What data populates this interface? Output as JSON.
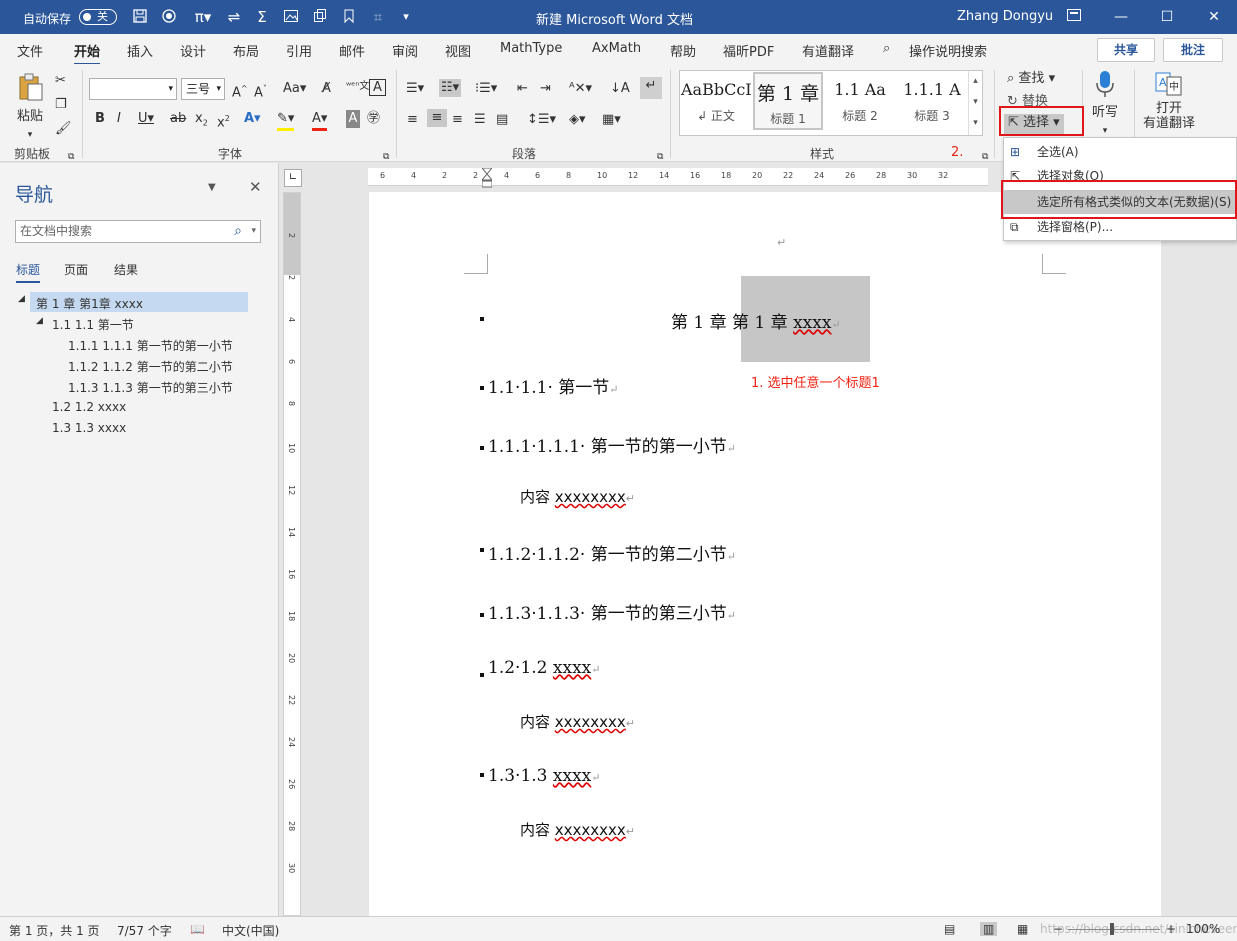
{
  "title_bar": {
    "autosave_label": "自动保存",
    "autosave_state": "关",
    "doc_title": "新建 Microsoft Word 文档",
    "user": "Zhang Dongyu"
  },
  "tabs": [
    "文件",
    "开始",
    "插入",
    "设计",
    "布局",
    "引用",
    "邮件",
    "审阅",
    "视图",
    "MathType",
    "AxMath",
    "帮助",
    "福昕PDF",
    "有道翻译"
  ],
  "active_tab": "开始",
  "tell_me": "操作说明搜索",
  "share_label": "共享",
  "comments_label": "批注",
  "ribbon": {
    "clipboard": {
      "paste": "粘贴",
      "group": "剪贴板"
    },
    "font": {
      "font_name": "",
      "font_size": "三号",
      "group": "字体"
    },
    "paragraph": {
      "group": "段落"
    },
    "styles": {
      "group": "样式",
      "items": [
        {
          "preview": "AaBbCcI",
          "name": "↲ 正文"
        },
        {
          "preview": "第 1 章",
          "name": "标题 1"
        },
        {
          "preview": "1.1  Aa",
          "name": "标题 2"
        },
        {
          "preview": "1.1.1  A",
          "name": "标题 3"
        }
      ]
    },
    "editing": {
      "find": "查找",
      "replace": "替换",
      "select": "选择"
    },
    "voice": {
      "dictate": "听写"
    },
    "translate": {
      "line1": "打开",
      "line2": "有道翻译"
    }
  },
  "select_menu": [
    {
      "label": "全选(A)",
      "icon": "select-all-icon"
    },
    {
      "label": "选择对象(O)",
      "icon": "cursor-icon"
    },
    {
      "label": "选定所有格式类似的文本(无数据)(S)",
      "icon": ""
    },
    {
      "label": "选择窗格(P)...",
      "icon": "selection-pane-icon"
    }
  ],
  "nav": {
    "title": "导航",
    "search_placeholder": "在文档中搜索",
    "tabs": [
      "标题",
      "页面",
      "结果"
    ],
    "items": [
      {
        "text": "第 1 章 第1章 xxxx",
        "level": 1
      },
      {
        "text": "1.1 1.1 第一节",
        "level": 2
      },
      {
        "text": "1.1.1 1.1.1 第一节的第一小节",
        "level": 3
      },
      {
        "text": "1.1.2 1.1.2 第一节的第二小节",
        "level": 3
      },
      {
        "text": "1.1.3 1.1.3 第一节的第三小节",
        "level": 3
      },
      {
        "text": "1.2 1.2 xxxx",
        "level": 2
      },
      {
        "text": "1.3 1.3 xxxx",
        "level": 2
      }
    ]
  },
  "document": {
    "chapter": {
      "prefix": "第 1 章 ",
      "text": "第 1 章 ",
      "tail": "xxxx"
    },
    "h2_1": {
      "num": "1.1·1.1· ",
      "text": "第一节"
    },
    "h3_1": {
      "num": "1.1.1·1.1.1· ",
      "text": "第一节的第一小节"
    },
    "content1": {
      "label": "内容 ",
      "x": "xxxxxxxx"
    },
    "h3_2": {
      "num": "1.1.2·1.1.2· ",
      "text": "第一节的第二小节"
    },
    "h3_3": {
      "num": "1.1.3·1.1.3· ",
      "text": "第一节的第三小节"
    },
    "h2_2": {
      "num": "1.2·1.2 ",
      "text": "xxxx"
    },
    "content2": {
      "label": "内容 ",
      "x": "xxxxxxxx"
    },
    "h2_3": {
      "num": "1.3·1.3 ",
      "text": "xxxx"
    },
    "content3": {
      "label": "内容 ",
      "x": "xxxxxxxx"
    }
  },
  "annotations": {
    "step1": "1. 选中任意一个标题1",
    "step2": "2."
  },
  "ruler_h": [
    "6",
    "4",
    "2",
    "2",
    "4",
    "6",
    "8",
    "10",
    "12",
    "14",
    "16",
    "18",
    "20",
    "22",
    "24",
    "26",
    "28",
    "30",
    "32"
  ],
  "ruler_v": [
    "2",
    "2",
    "4",
    "6",
    "8",
    "10",
    "12",
    "14",
    "16",
    "18",
    "20",
    "22",
    "24",
    "26",
    "28",
    "30"
  ],
  "status": {
    "page": "第 1 页，共 1 页",
    "words": "7/57 个字",
    "lang": "中文(中国)",
    "zoom": "100%",
    "watermark": "https://blog.csdn.net/sinicheveen"
  }
}
